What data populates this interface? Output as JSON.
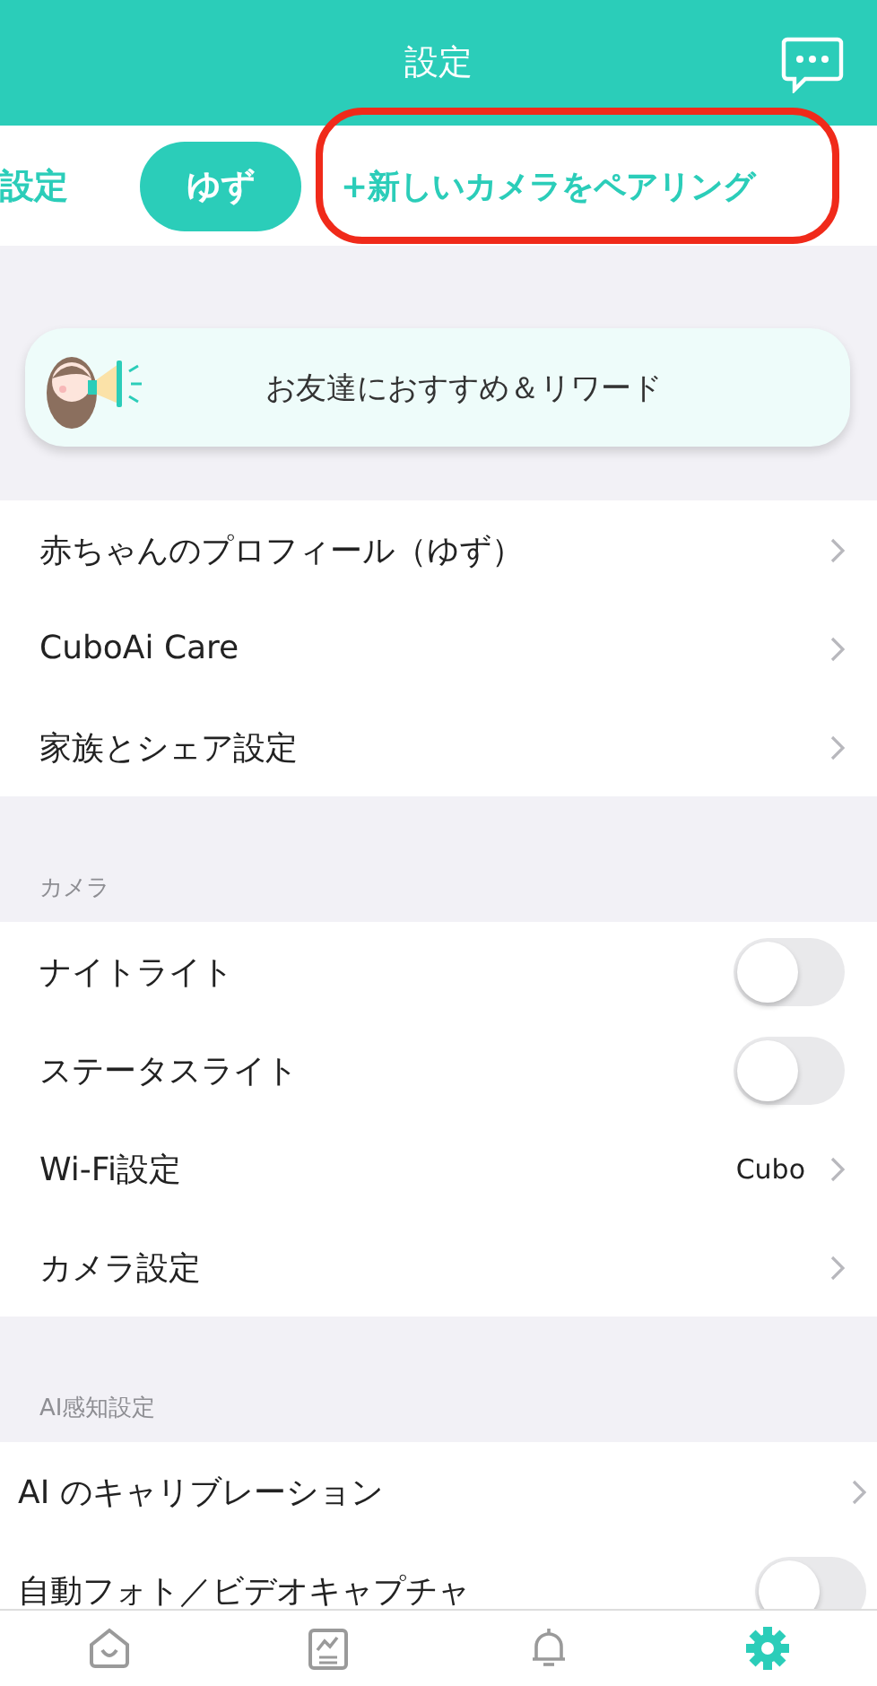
{
  "header": {
    "title": "設定"
  },
  "tabs": [
    {
      "label": "設定",
      "kind": "tab",
      "selected": false
    },
    {
      "label": "ゆず",
      "kind": "tab",
      "selected": true
    },
    {
      "label": "+新しいカメラをペアリング",
      "kind": "action",
      "selected": false
    }
  ],
  "banner": {
    "text": "お友達におすすめ＆リワード"
  },
  "sections": [
    {
      "rows": [
        {
          "kind": "link",
          "label": "赤ちゃんのプロフィール（ゆず）"
        },
        {
          "kind": "link",
          "label": "CuboAi Care"
        },
        {
          "kind": "link",
          "label": "家族とシェア設定"
        }
      ]
    },
    {
      "heading": "カメラ",
      "rows": [
        {
          "kind": "toggle",
          "label": "ナイトライト",
          "on": false
        },
        {
          "kind": "toggle",
          "label": "ステータスライト",
          "on": false
        },
        {
          "kind": "link",
          "label": "Wi-Fi設定",
          "value": "Cubo"
        },
        {
          "kind": "link",
          "label": "カメラ設定"
        }
      ]
    },
    {
      "heading": "AI感知設定",
      "shifted": true,
      "rows": [
        {
          "kind": "link",
          "label": "AI のキャリブレーション"
        },
        {
          "kind": "toggle",
          "label": "自動フォト／ビデオキャプチャ",
          "on": false
        }
      ]
    }
  ],
  "tab_bar": [
    {
      "kind": "home",
      "selected": false
    },
    {
      "kind": "report",
      "selected": false
    },
    {
      "kind": "bell",
      "selected": false
    },
    {
      "kind": "gear",
      "selected": true
    }
  ]
}
